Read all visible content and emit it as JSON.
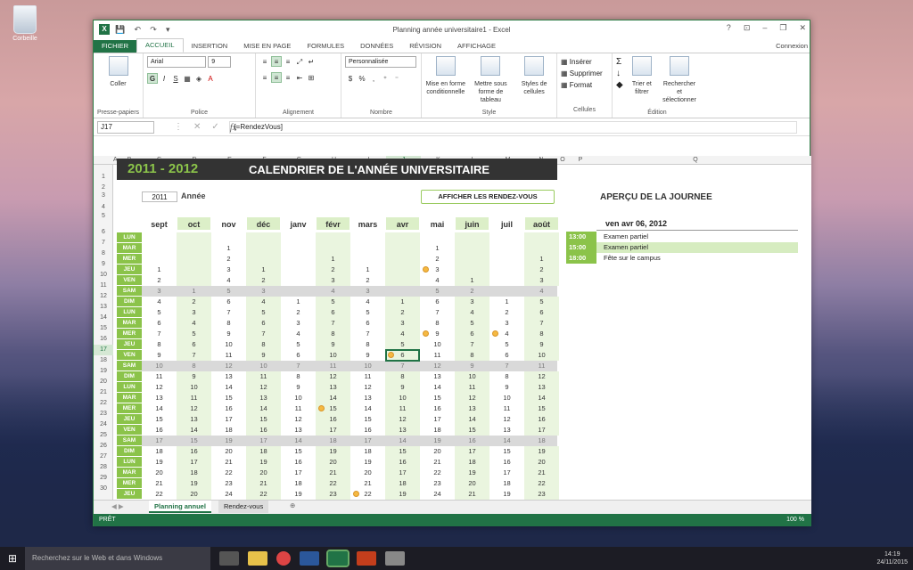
{
  "desktop": {
    "recycle_label": "Corbeille"
  },
  "window": {
    "title": "Planning année universitaire1 - Excel",
    "controls": [
      "?",
      "⊡",
      "–",
      "❐",
      "✕"
    ]
  },
  "qat": [
    "💾",
    "↶",
    "↷",
    "▾"
  ],
  "tabs": [
    "FICHIER",
    "ACCUEIL",
    "INSERTION",
    "MISE EN PAGE",
    "FORMULES",
    "DONNÉES",
    "RÉVISION",
    "AFFICHAGE"
  ],
  "connexion": "Connexion",
  "ribbon": {
    "paste": "Coller",
    "presse": "Presse-papiers",
    "font_name": "Arial",
    "font_size": "9",
    "police": "Police",
    "alignement": "Alignement",
    "number_format": "Personnalisée",
    "nombre": "Nombre",
    "mfc": "Mise en forme conditionnelle",
    "mft": "Mettre sous forme de tableau",
    "styles_cells": "Styles de cellules",
    "style": "Style",
    "inserer": "Insérer",
    "supprimer": "Supprimer",
    "format": "Format",
    "cellules": "Cellules",
    "trier": "Trier et filtrer",
    "rechercher": "Rechercher et sélectionner",
    "edition": "Édition"
  },
  "formula": {
    "namebox": "J17",
    "fx": "fx",
    "content": "{=RendezVous]"
  },
  "columns": [
    "A",
    "B",
    "C",
    "D",
    "E",
    "F",
    "G",
    "H",
    "I",
    "J",
    "K",
    "L",
    "M",
    "N",
    "O",
    "P",
    "Q"
  ],
  "rows": [
    "1",
    "2",
    "3",
    "4",
    "5",
    "6",
    "7",
    "8",
    "9",
    "10",
    "11",
    "12",
    "13",
    "14",
    "15",
    "16",
    "17",
    "18",
    "19",
    "20",
    "21",
    "22",
    "23",
    "24",
    "25",
    "26",
    "27",
    "28",
    "29",
    "30"
  ],
  "calendar": {
    "year_title": "2011 - 2012",
    "title": "CALENDRIER DE L'ANNÉE UNIVERSITAIRE",
    "year": "2011",
    "year_label": "Année",
    "button": "AFFICHER LES RENDEZ-VOUS",
    "months": [
      "sept",
      "oct",
      "nov",
      "déc",
      "janv",
      "févr",
      "mars",
      "avr",
      "mai",
      "juin",
      "juil",
      "août"
    ],
    "days": [
      "LUN",
      "MAR",
      "MER",
      "JEU",
      "VEN",
      "SAM",
      "DIM",
      "LUN",
      "MAR",
      "MER",
      "JEU",
      "VEN",
      "SAM",
      "DIM",
      "LUN",
      "MAR",
      "MER",
      "JEU",
      "VEN",
      "SAM",
      "DIM",
      "LUN",
      "MAR",
      "MER",
      "JEU",
      "VEN"
    ],
    "grid": [
      [
        "",
        "",
        "",
        "",
        "",
        "",
        "",
        "",
        "",
        "",
        "",
        ""
      ],
      [
        "",
        "",
        "1",
        "",
        "",
        "",
        "",
        "",
        "1",
        "",
        "",
        ""
      ],
      [
        "",
        "",
        "2",
        "",
        "",
        "1",
        "",
        "",
        "2",
        "",
        "",
        "1"
      ],
      [
        "1",
        "",
        "3",
        "1",
        "",
        "2",
        "1",
        "",
        "3",
        "",
        "",
        "2"
      ],
      [
        "2",
        "",
        "4",
        "2",
        "",
        "3",
        "2",
        "",
        "4",
        "1",
        "",
        "3"
      ],
      [
        "3",
        "1",
        "5",
        "3",
        "",
        "4",
        "3",
        "",
        "5",
        "2",
        "",
        "4"
      ],
      [
        "4",
        "2",
        "6",
        "4",
        "1",
        "5",
        "4",
        "1",
        "6",
        "3",
        "1",
        "5"
      ],
      [
        "5",
        "3",
        "7",
        "5",
        "2",
        "6",
        "5",
        "2",
        "7",
        "4",
        "2",
        "6"
      ],
      [
        "6",
        "4",
        "8",
        "6",
        "3",
        "7",
        "6",
        "3",
        "8",
        "5",
        "3",
        "7"
      ],
      [
        "7",
        "5",
        "9",
        "7",
        "4",
        "8",
        "7",
        "4",
        "9",
        "6",
        "4",
        "8"
      ],
      [
        "8",
        "6",
        "10",
        "8",
        "5",
        "9",
        "8",
        "5",
        "10",
        "7",
        "5",
        "9"
      ],
      [
        "9",
        "7",
        "11",
        "9",
        "6",
        "10",
        "9",
        "6",
        "11",
        "8",
        "6",
        "10"
      ],
      [
        "10",
        "8",
        "12",
        "10",
        "7",
        "11",
        "10",
        "7",
        "12",
        "9",
        "7",
        "11"
      ],
      [
        "11",
        "9",
        "13",
        "11",
        "8",
        "12",
        "11",
        "8",
        "13",
        "10",
        "8",
        "12"
      ],
      [
        "12",
        "10",
        "14",
        "12",
        "9",
        "13",
        "12",
        "9",
        "14",
        "11",
        "9",
        "13"
      ],
      [
        "13",
        "11",
        "15",
        "13",
        "10",
        "14",
        "13",
        "10",
        "15",
        "12",
        "10",
        "14"
      ],
      [
        "14",
        "12",
        "16",
        "14",
        "11",
        "15",
        "14",
        "11",
        "16",
        "13",
        "11",
        "15"
      ],
      [
        "15",
        "13",
        "17",
        "15",
        "12",
        "16",
        "15",
        "12",
        "17",
        "14",
        "12",
        "16"
      ],
      [
        "16",
        "14",
        "18",
        "16",
        "13",
        "17",
        "16",
        "13",
        "18",
        "15",
        "13",
        "17"
      ],
      [
        "17",
        "15",
        "19",
        "17",
        "14",
        "18",
        "17",
        "14",
        "19",
        "16",
        "14",
        "18"
      ],
      [
        "18",
        "16",
        "20",
        "18",
        "15",
        "19",
        "18",
        "15",
        "20",
        "17",
        "15",
        "19"
      ],
      [
        "19",
        "17",
        "21",
        "19",
        "16",
        "20",
        "19",
        "16",
        "21",
        "18",
        "16",
        "20"
      ],
      [
        "20",
        "18",
        "22",
        "20",
        "17",
        "21",
        "20",
        "17",
        "22",
        "19",
        "17",
        "21"
      ],
      [
        "21",
        "19",
        "23",
        "21",
        "18",
        "22",
        "21",
        "18",
        "23",
        "20",
        "18",
        "22"
      ],
      [
        "22",
        "20",
        "24",
        "22",
        "19",
        "23",
        "22",
        "19",
        "24",
        "21",
        "19",
        "23"
      ]
    ]
  },
  "apercu": {
    "title": "APERÇU DE LA JOURNEE",
    "date": "ven avr 06, 2012",
    "events": [
      {
        "time": "13:00",
        "desc": "Examen partiel"
      },
      {
        "time": "15:00",
        "desc": "Examen partiel"
      },
      {
        "time": "18:00",
        "desc": "Fête sur le campus"
      }
    ]
  },
  "sheets": [
    "Planning annuel",
    "Rendez-vous"
  ],
  "status": {
    "ready": "PRÊT",
    "zoom": "100 %"
  },
  "taskbar": {
    "search": "Recherchez sur le Web et dans Windows",
    "time": "14:19",
    "date": "24/11/2015"
  }
}
